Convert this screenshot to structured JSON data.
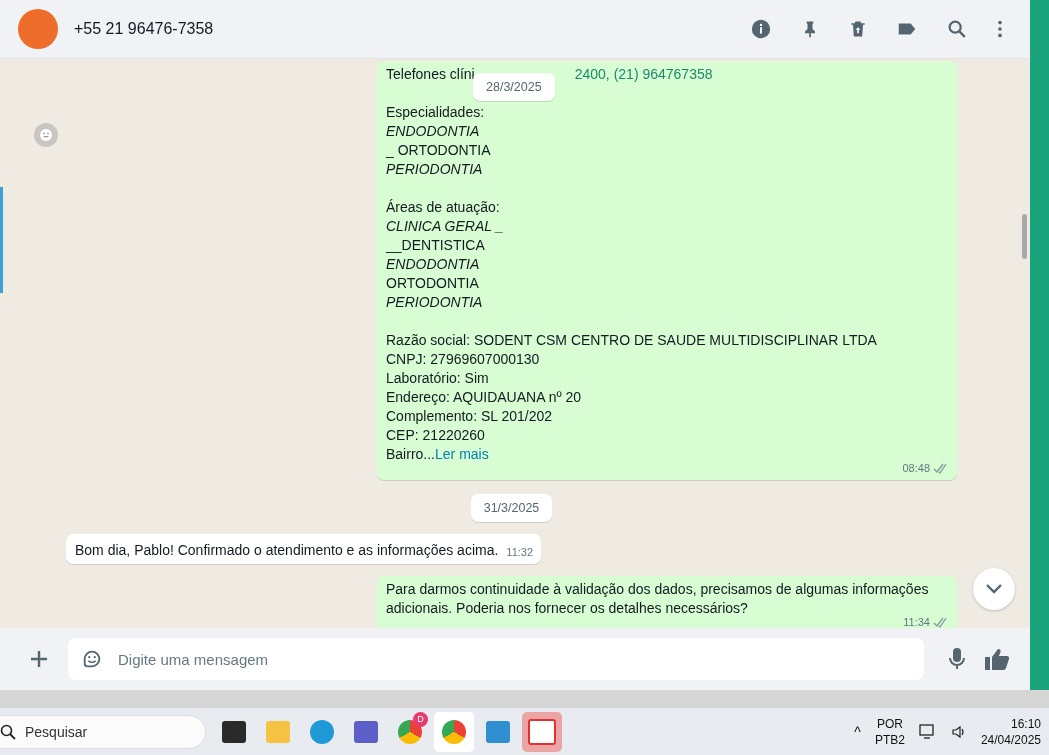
{
  "header": {
    "contact": "+55 21 96476-7358"
  },
  "floating_date": "28/3/2025",
  "messages": [
    {
      "kind": "out",
      "time": "08:48",
      "blocks": [
        [
          {
            "kind": "phone",
            "text": "Telefones clíni",
            "link": "2400, (21) 964767358"
          }
        ],
        [
          {
            "kind": "plain",
            "text": "Especialidades:"
          },
          {
            "kind": "italic",
            "text": "ENDODONTIA"
          },
          {
            "kind": "plain",
            "text": "_ ORTODONTIA"
          },
          {
            "kind": "italic",
            "text": "PERIODONTIA"
          }
        ],
        [
          {
            "kind": "plain",
            "text": "Áreas de atuação:"
          },
          {
            "kind": "italic",
            "text": "CLINICA GERAL _"
          },
          {
            "kind": "plain",
            "text": "__DENTISTICA"
          },
          {
            "kind": "italic",
            "text": "ENDODONTIA"
          },
          {
            "kind": "plain",
            "text": "ORTODONTIA"
          },
          {
            "kind": "italic",
            "text": "PERIODONTIA"
          }
        ],
        [
          {
            "kind": "plain",
            "text": "Razão social: SODENT CSM CENTRO DE SAUDE MULTIDISCIPLINAR LTDA"
          },
          {
            "kind": "plain",
            "text": "CNPJ: 27969607000130"
          },
          {
            "kind": "plain",
            "text": "Laboratório: Sim"
          },
          {
            "kind": "plain",
            "text": "Endereço: AQUIDAUANA nº 20"
          },
          {
            "kind": "plain",
            "text": "Complemento: SL 201/202"
          },
          {
            "kind": "plain",
            "text": "CEP: 21220260"
          },
          {
            "kind": "more",
            "text": "Bairro...",
            "link": "Ler mais"
          }
        ]
      ]
    },
    {
      "kind": "date",
      "text": "31/3/2025"
    },
    {
      "kind": "in",
      "time": "11:32",
      "text": "Bom dia, Pablo! Confirmado o atendimento e as informações acima."
    },
    {
      "kind": "out",
      "time": "11:34",
      "blocks": [
        [
          {
            "kind": "plain",
            "text": "Para darmos continuidade à validação dos dados, precisamos de algumas informações adicionais. Poderia nos fornecer os detalhes necessários?"
          }
        ]
      ]
    }
  ],
  "composer": {
    "placeholder": "Digite uma mensagem"
  },
  "taskbar": {
    "search_placeholder": "Pesquisar",
    "badge": "D",
    "tray_chevron": "^",
    "lang": "POR",
    "layout": "PTB2",
    "time": "16:10",
    "date": "24/04/2025"
  }
}
